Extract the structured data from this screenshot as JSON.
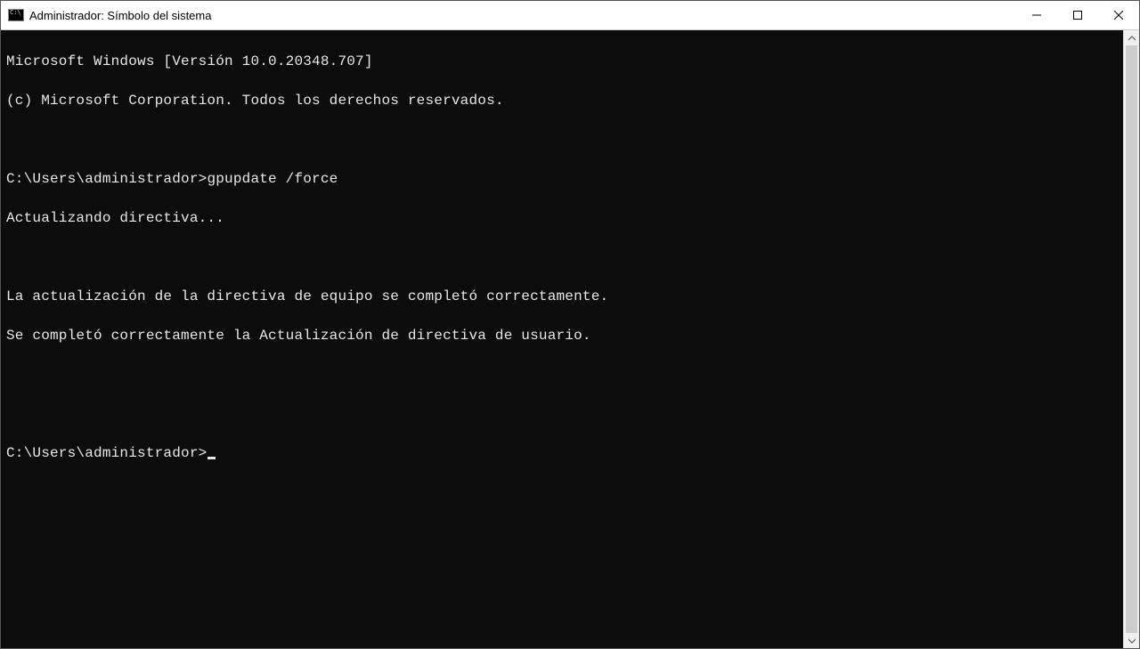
{
  "titlebar": {
    "title": "Administrador: Símbolo del sistema"
  },
  "terminal": {
    "line1": "Microsoft Windows [Versión 10.0.20348.707]",
    "line2": "(c) Microsoft Corporation. Todos los derechos reservados.",
    "blank1": "",
    "prompt1": "C:\\Users\\administrador>",
    "cmd1": "gpupdate /force",
    "line3": "Actualizando directiva...",
    "blank2": "",
    "line4": "La actualización de la directiva de equipo se completó correctamente.",
    "line5": "Se completó correctamente la Actualización de directiva de usuario.",
    "blank3": "",
    "blank4": "",
    "prompt2": "C:\\Users\\administrador>"
  }
}
